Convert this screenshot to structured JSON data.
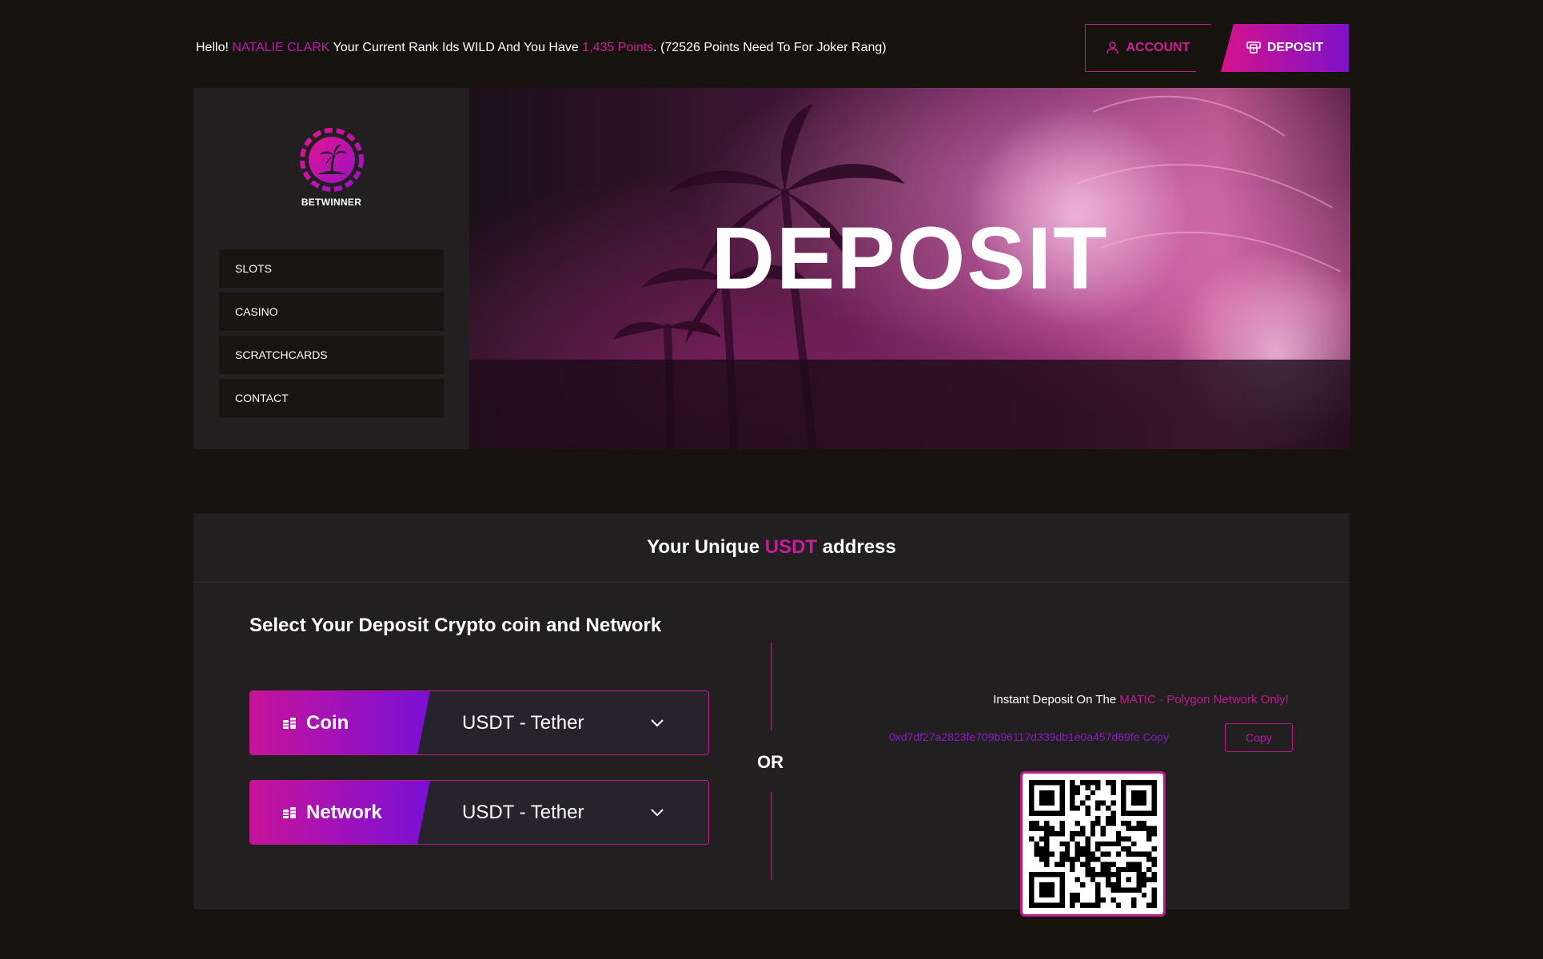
{
  "topbar": {
    "greeting_hello": "Hello! ",
    "user_name": "NATALIE CLARK",
    "rank_text": " Your Current Rank Ids WILD And  You Have ",
    "points_value": "1,435  Points",
    "points_suffix": ". (72526 Points Need To For Joker Rang)",
    "account_label": "ACCOUNT",
    "deposit_label": "DEPOSIT"
  },
  "logo": {
    "text": "BETWINNER"
  },
  "sidebar": {
    "items": [
      {
        "label": "SLOTS"
      },
      {
        "label": "CASINO"
      },
      {
        "label": "SCRATCHCARDS"
      },
      {
        "label": "CONTACT"
      }
    ]
  },
  "banner": {
    "title": "DEPOSIT"
  },
  "panel": {
    "header_prefix": "Your Unique ",
    "header_accent": "USDT",
    "header_suffix": " address",
    "select_title": "Select Your Deposit Crypto coin and Network",
    "coin_label": "Coin",
    "coin_value": "USDT - Tether",
    "network_label": "Network",
    "network_value": "USDT - Tether",
    "or_text": "OR",
    "instant_prefix": "Instant Deposit On The ",
    "instant_accent": "MATIC - Polygon Network Only!",
    "address": "0xd7df27a2823fe709b96117d339db1e0a457d69fe Copy",
    "copy_label": "Copy"
  },
  "colors": {
    "accent_pink": "#d01f9a",
    "accent_purple": "#7f11c9",
    "background": "#16130f",
    "panel": "#221f21"
  }
}
